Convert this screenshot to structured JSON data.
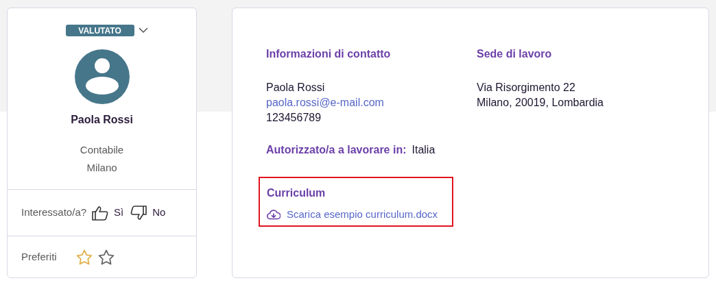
{
  "profile": {
    "status": "VALUTATO",
    "name": "Paola Rossi",
    "role": "Contabile",
    "city": "Milano"
  },
  "interest": {
    "label": "Interessato/a?",
    "yes": "Sì",
    "no": "No"
  },
  "favorites": {
    "label": "Preferiti",
    "star_buttons": [
      {
        "selected": true
      },
      {
        "selected": false
      }
    ]
  },
  "contact": {
    "title": "Informazioni di contatto",
    "name": "Paola Rossi",
    "email": "paola.rossi@e-mail.com",
    "phone": "123456789"
  },
  "workplace": {
    "title": "Sede di lavoro",
    "address": "Via Risorgimento 22",
    "city": "Milano, 20019, Lombardia"
  },
  "authorized": {
    "label": "Autorizzato/a a lavorare in:",
    "value": "Italia"
  },
  "resume": {
    "title": "Curriculum",
    "link": "Scarica esempio curriculum.docx",
    "highlighted": true
  }
}
